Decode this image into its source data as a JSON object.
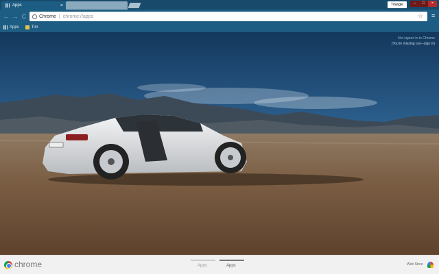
{
  "tabs": [
    {
      "title": "Apps",
      "active": true
    },
    {
      "title": "",
      "active": false
    }
  ],
  "profile": {
    "name": "Triangle"
  },
  "window_controls": {
    "minimize": "–",
    "maximize": "□",
    "close": "×"
  },
  "toolbar": {
    "back": "←",
    "forward": "→",
    "reload": "C",
    "omnibox_scheme": "Chrome",
    "omnibox_url": "chrome://apps",
    "star": "☆",
    "menu": "≡"
  },
  "bookmarks": [
    {
      "label": "Apps",
      "icon": "grid-icon"
    },
    {
      "label": "Tim",
      "icon": "folder-icon"
    }
  ],
  "signin": {
    "line1": "Not signed in to Chrome",
    "line2": "(You're missing out—sign in)"
  },
  "bottom": {
    "brand": "chrome",
    "page_tabs": [
      "Apps",
      "Apps"
    ],
    "webstore": "Web Store"
  },
  "colors": {
    "frame": "#174a6b",
    "toolbar": "#1d5d83",
    "close_button": "#b52b2b"
  }
}
